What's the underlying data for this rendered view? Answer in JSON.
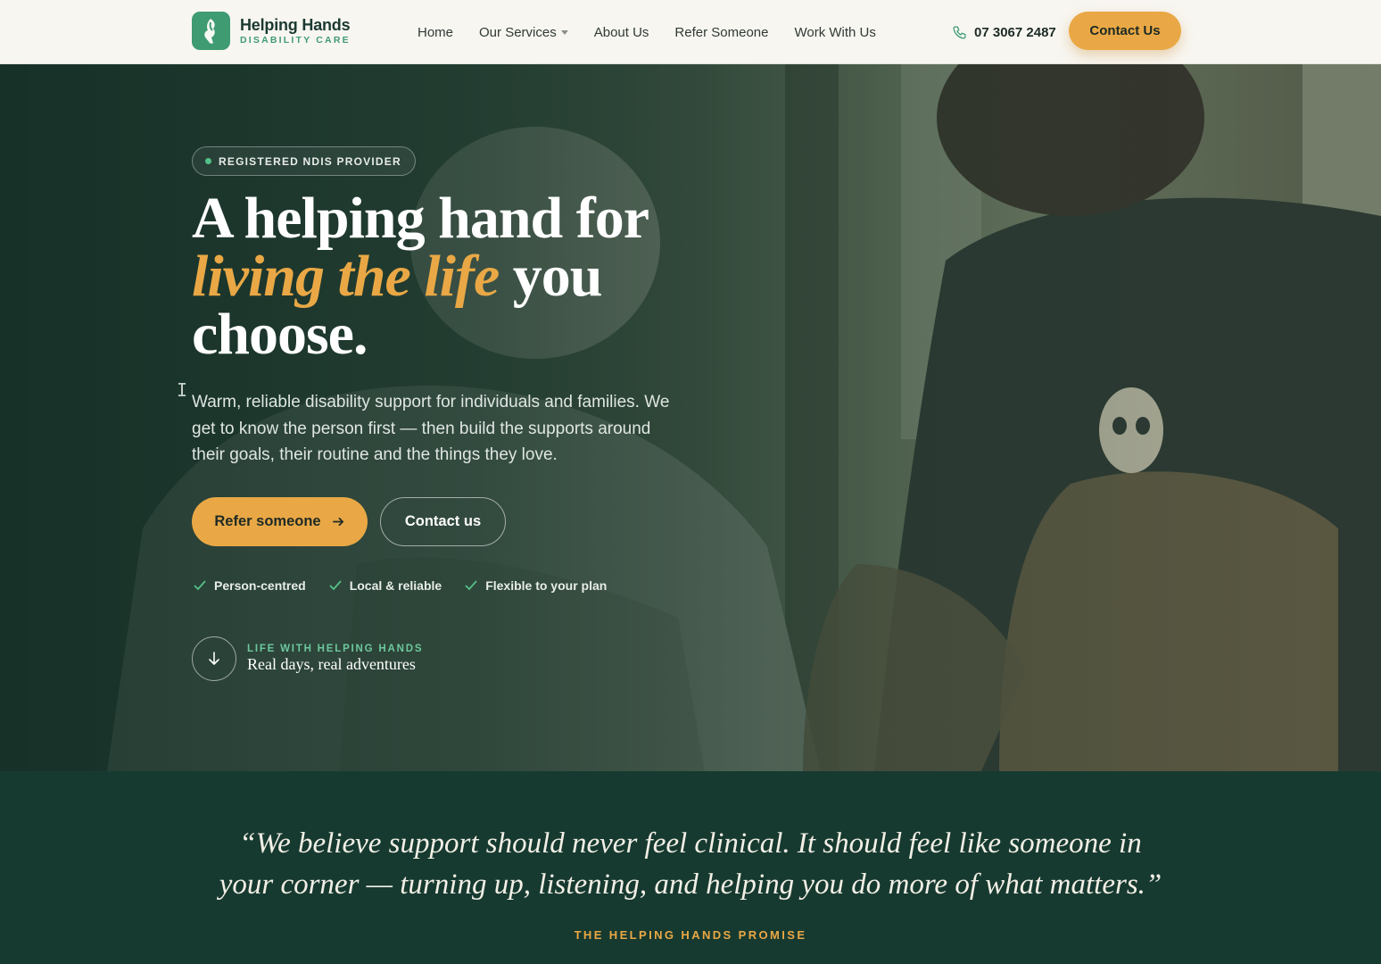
{
  "brand": {
    "name": "Helping Hands",
    "subtitle": "DISABILITY CARE"
  },
  "nav": {
    "items": [
      {
        "label": "Home"
      },
      {
        "label": "Our Services",
        "has_dropdown": true
      },
      {
        "label": "About Us"
      },
      {
        "label": "Refer Someone"
      },
      {
        "label": "Work With Us"
      }
    ]
  },
  "header": {
    "phone": "07 3067 2487",
    "contact_label": "Contact Us"
  },
  "hero": {
    "badge": "REGISTERED NDIS PROVIDER",
    "headline_part1": "A helping hand for",
    "headline_accent": "living the life",
    "headline_part2": "you",
    "headline_part3": "choose.",
    "lead": "Warm, reliable disability support for individuals and families. We get to know the person first — then build the supports around their goals, their routine and the things they love.",
    "primary_cta": "Refer someone",
    "secondary_cta": "Contact us",
    "checks": [
      "Person-centred",
      "Local & reliable",
      "Flexible to your plan"
    ],
    "scroll_kicker": "LIFE WITH HELPING HANDS",
    "scroll_title": "Real days, real adventures"
  },
  "quote": {
    "line1": "“We believe support should never feel clinical. It should feel like someone in",
    "line2": "your corner — turning up, listening, and helping you do more of what matters.”",
    "label": "THE HELPING HANDS PROMISE"
  },
  "colors": {
    "accent": "#e9a845",
    "brand_green": "#3f9b72",
    "dark_green": "#173a30"
  },
  "icons": [
    "hand-logo-icon",
    "chevron-down-icon",
    "phone-icon",
    "arrow-right-icon",
    "check-icon",
    "arrow-down-icon"
  ]
}
